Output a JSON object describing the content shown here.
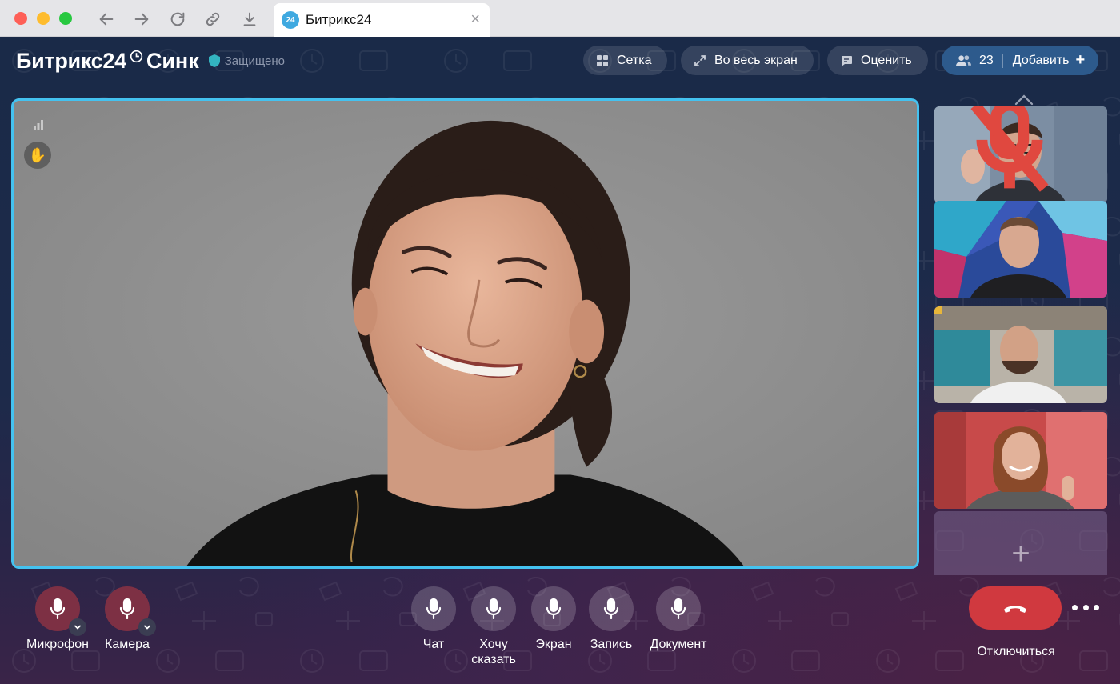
{
  "browser": {
    "tab_title": "Битрикс24",
    "tab_logo": "24"
  },
  "header": {
    "brand": "Битрикс24",
    "product": "Синк",
    "secure_label": "Защищено"
  },
  "toolbar": {
    "grid_label": "Сетка",
    "fullscreen_label": "Во весь экран",
    "rate_label": "Оценить",
    "participants_count": "23",
    "add_label": "Добавить"
  },
  "controls": {
    "microphone_label": "Микрофон",
    "camera_label": "Камера",
    "chat_label": "Чат",
    "raise_hand_label": "Хочу сказать",
    "screen_label": "Экран",
    "record_label": "Запись",
    "document_label": "Документ",
    "hangup_label": "Отключиться"
  },
  "colors": {
    "accent": "#44c2f0",
    "hangup": "#d0393f",
    "add_button": "#2d5a8c"
  }
}
